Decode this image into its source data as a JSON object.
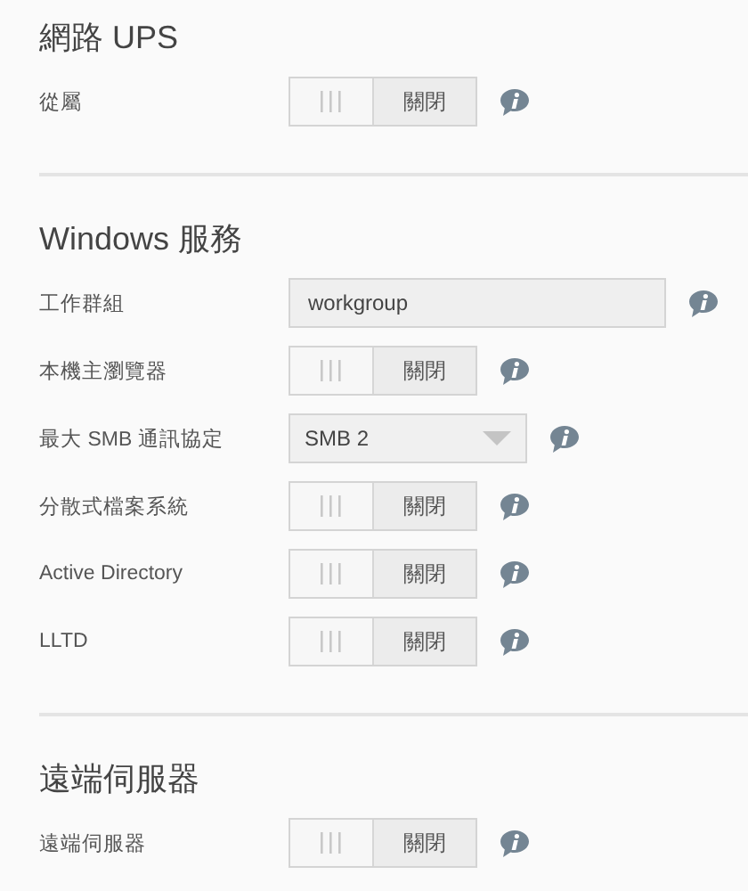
{
  "sections": [
    {
      "title": "網路 UPS",
      "rows": [
        {
          "label": "從屬",
          "kind": "toggle",
          "on": false,
          "state_text": "關閉"
        }
      ]
    },
    {
      "title": "Windows 服務",
      "rows": [
        {
          "label": "工作群組",
          "kind": "text",
          "value": "workgroup"
        },
        {
          "label": "本機主瀏覽器",
          "kind": "toggle",
          "on": false,
          "state_text": "關閉"
        },
        {
          "label": "最大 SMB 通訊協定",
          "kind": "select",
          "value": "SMB 2"
        },
        {
          "label": "分散式檔案系統",
          "kind": "toggle",
          "on": false,
          "state_text": "關閉"
        },
        {
          "label": "Active Directory",
          "kind": "toggle",
          "on": false,
          "state_text": "關閉"
        },
        {
          "label": "LLTD",
          "kind": "toggle",
          "on": false,
          "state_text": "關閉"
        }
      ]
    },
    {
      "title": "遠端伺服器",
      "rows": [
        {
          "label": "遠端伺服器",
          "kind": "toggle",
          "on": false,
          "state_text": "關閉"
        }
      ]
    }
  ]
}
